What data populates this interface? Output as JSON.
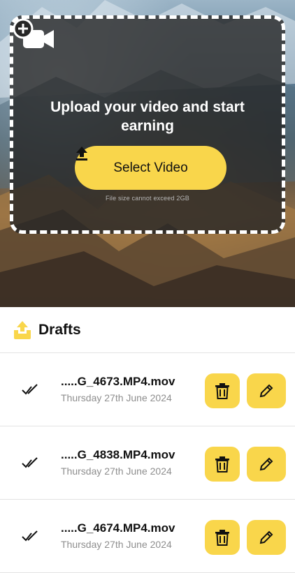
{
  "upload": {
    "title": "Upload your video and start earning",
    "select_button_label": "Select Video",
    "size_note": "File size cannot exceed 2GB"
  },
  "drafts": {
    "title": "Drafts",
    "items": [
      {
        "file_name": ".....G_4673.MP4.mov",
        "date": "Thursday 27th June 2024"
      },
      {
        "file_name": ".....G_4838.MP4.mov",
        "date": "Thursday 27th June 2024"
      },
      {
        "file_name": ".....G_4674.MP4.mov",
        "date": "Thursday 27th June 2024"
      }
    ]
  },
  "colors": {
    "accent": "#f9d64b",
    "card_background": "#262626",
    "muted_text": "#8e8e8e"
  },
  "icons": {
    "camera": "video-camera-plus-icon",
    "upload": "upload-arrow-icon",
    "drafts": "tray-upload-icon",
    "status": "double-check-icon",
    "delete": "trash-icon",
    "edit": "pencil-icon"
  }
}
